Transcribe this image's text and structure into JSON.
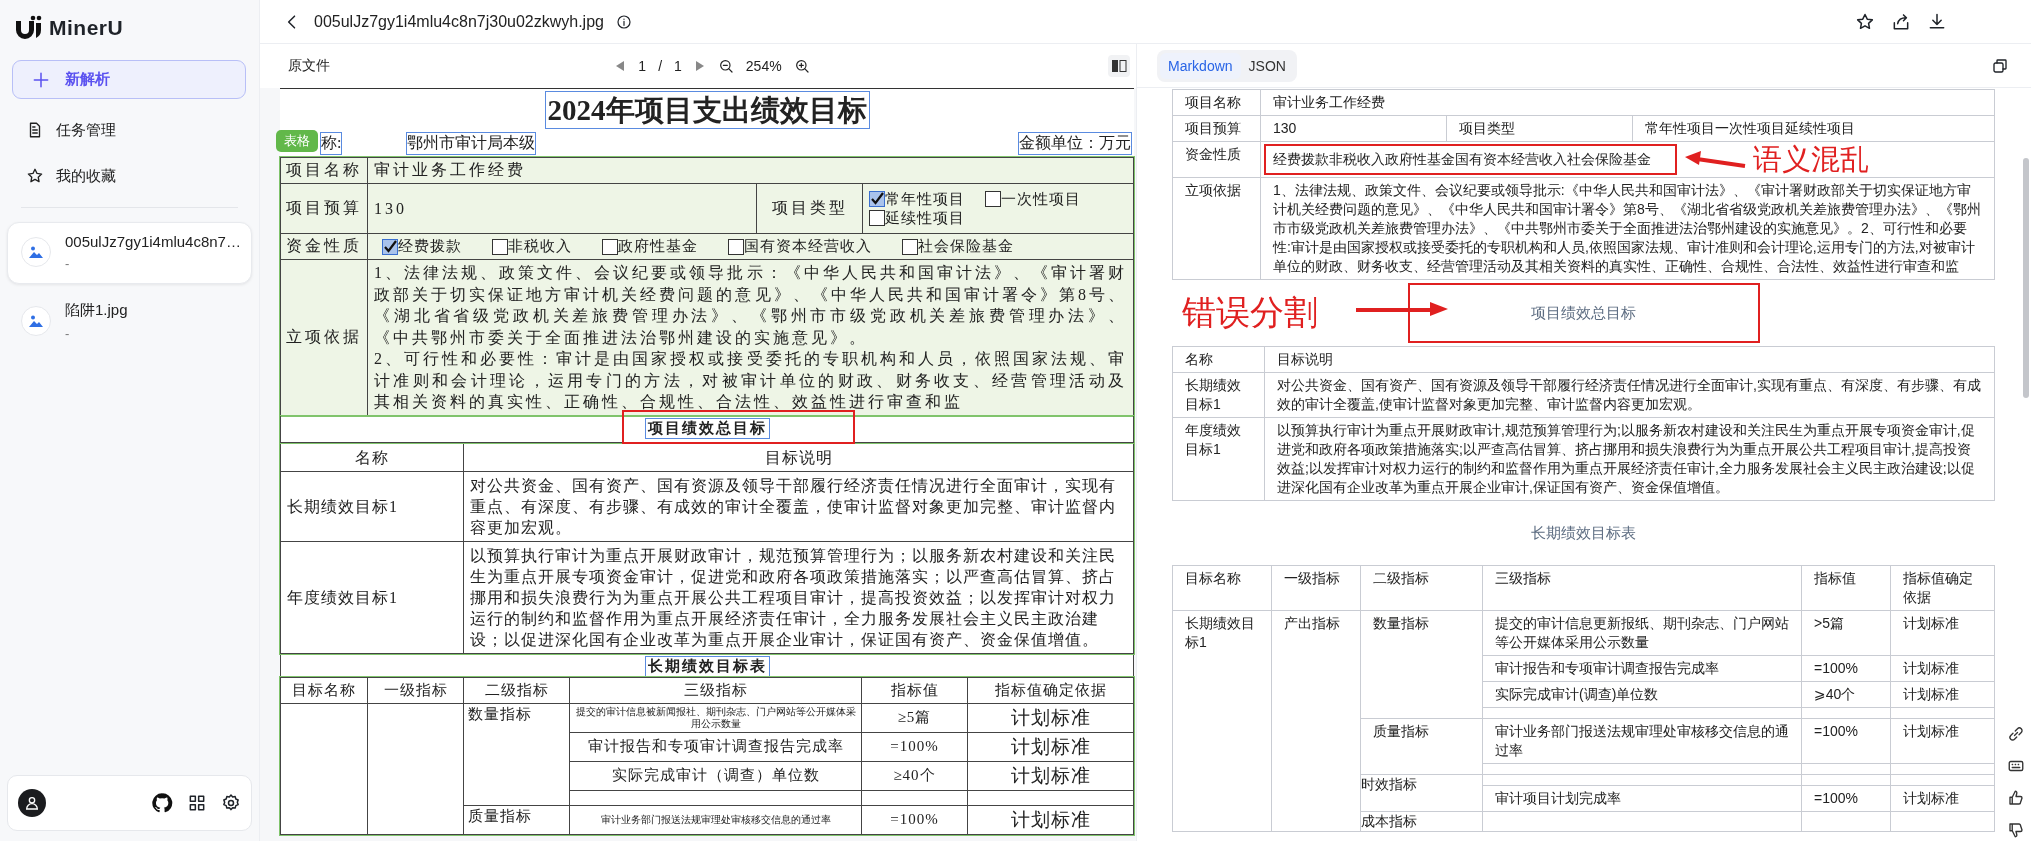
{
  "sidebar": {
    "logo": "MinerU",
    "new_task": "新解析",
    "nav": [
      "任务管理",
      "我的收藏"
    ],
    "files": [
      {
        "name": "005ulJz7gy1i4mlu4c8n7…",
        "meta": "-",
        "selected": true
      },
      {
        "name": "陷阱1.jpg",
        "meta": "-",
        "selected": false
      }
    ]
  },
  "header": {
    "file_name": "005ulJz7gy1i4mlu4c8n7j30u02zkwyh.jpg"
  },
  "viewer": {
    "label": "原文件",
    "page": "1",
    "page_separator": "/",
    "page_count": "1",
    "zoom": "254%"
  },
  "document": {
    "title": "2024年项目支出绩效目标",
    "block_tag": "表格",
    "unit_label": "称:",
    "unit_name": "鄂州市审计局本级",
    "amount_unit": "金额单位：万元",
    "project_name_label": "项目名称",
    "project_name": "审计业务工作经费",
    "budget_label": "项目预算",
    "budget": "130",
    "type_label": "项目类型",
    "project_types": [
      {
        "label": "常年性项目",
        "checked": true
      },
      {
        "label": "延续性项目",
        "checked": false
      },
      {
        "label": "一次性项目",
        "checked": false
      }
    ],
    "fund_label": "资金性质",
    "fund_types": [
      {
        "label": "经费拨款",
        "checked": true
      },
      {
        "label": "非税收入",
        "checked": false
      },
      {
        "label": "政府性基金",
        "checked": false
      },
      {
        "label": "国有资本经营收入",
        "checked": false
      },
      {
        "label": "社会保险基金",
        "checked": false
      }
    ],
    "basis_label": "立项依据",
    "basis": [
      "1、法律法规、政策文件、会议纪要或领导批示：《中华人民共和国审计法》、《审计署财政部关于切实保证地方审计机关经费问题的意见》、《中华人民共和国审计署令》第8号、《湖北省省级党政机关差旅费管理办法》、《鄂州市市级党政机关差旅费管理办法》、《中共鄂州市委关于全面推进法治鄂州建设的实施意见》。",
      "2、可行性和必要性：审计是由国家授权或接受委托的专职机构和人员，依照国家法规、审计准则和会计理论，运用专门的方法，对被审计单位的财政、财务收支、经营管理活动及其相关资料的真实性、正确性、合规性、合法性、效益性进行审查和监"
    ],
    "goal_section": "项目绩效总目标",
    "goal_section_flagged": true,
    "goal_columns": [
      "名称",
      "目标说明"
    ],
    "goals": [
      {
        "name": "长期绩效目标1",
        "text": "对公共资金、国有资产、国有资源及领导干部履行经济责任情况进行全面审计，实现有重点、有深度、有步骤、有成效的审计全覆盖，使审计监督对象更加完整、审计监督内容更加宏观。"
      },
      {
        "name": "年度绩效目标1",
        "text": "以预算执行审计为重点开展财政审计，规范预算管理行为；以服务新农村建设和关注民生为重点开展专项资金审计，促进党和政府各项政策措施落实；以严查高估冒算、挤占挪用和损失浪费行为为重点开展公共工程项目审计，提高投资效益；以发挥审计对权力运行的制约和监督作用为重点开展经济责任审计，全力服务发展社会主义民主政治建设；以促进深化国有企业改革为重点开展企业审计，保证国有资产、资金保值增值。"
      }
    ],
    "indicator_section": "长期绩效目标表",
    "indicator_columns": [
      "目标名称",
      "一级指标",
      "二级指标",
      "三级指标",
      "指标值",
      "指标值确定依据"
    ],
    "indicator_groups": [
      {
        "name": "数量指标",
        "rows": [
          {
            "kind": "small",
            "text": "提交的审计信息被新闻报社、期刊杂志、门户网站等公开媒体采用公示数量",
            "value": "≥5篇",
            "basis": "计划标准"
          },
          {
            "kind": "normal",
            "text": "审计报告和专项审计调查报告完成率",
            "value": "=100%",
            "basis": "计划标准"
          },
          {
            "kind": "normal",
            "text": "实际完成审计（调查）单位数",
            "value": "≥40个",
            "basis": "计划标准"
          },
          {
            "kind": "blank"
          }
        ]
      },
      {
        "name": "质量指标",
        "rows": [
          {
            "kind": "small",
            "text": "审计业务部门报送法规审理处审核移交信息的通过率",
            "value": "=100%",
            "basis": "计划标准"
          }
        ]
      }
    ]
  },
  "result": {
    "tabs": [
      {
        "label": "Markdown",
        "selected": true
      },
      {
        "label": "JSON",
        "selected": false
      }
    ],
    "summary_rows": [
      {
        "cells": [
          "项目名称",
          "审计业务工作经费"
        ]
      },
      {
        "cells": [
          "项目预算",
          "130",
          "项目类型",
          "常年性项目一次性项目延续性项目"
        ]
      },
      {
        "cells": [
          "资金性质",
          "经费拨款非税收入政府性基金国有资本经营收入社会保险基金"
        ],
        "annotation": "语义混乱"
      },
      {
        "cells": [
          "立项依据",
          "1、法律法规、政策文件、会议纪要或领导批示:《中华人民共和国审计法》、《审计署财政部关于切实保证地方审计机关经费问题的意见》、《中华人民共和国审计署令》第8号、《湖北省省级党政机关差旅费管理办法》、《鄂州市市级党政机关差旅费管理办法》、《中共鄂州市委关于全面推进法治鄂州建设的实施意见》。2、可行性和必要性:审计是由国家授权或接受委托的专职机构和人员,依照国家法规、审计准则和会计理论,运用专门的方法,对被审计单位的财政、财务收支、经营管理活动及其相关资料的真实性、正确性、合规性、合法性、效益性进行审查和监"
        ]
      }
    ],
    "goal_caption": "项目绩效总目标",
    "goal_caption_annotation": "错误分割",
    "goal_columns": [
      "名称",
      "目标说明"
    ],
    "goals": [
      {
        "name": "长期绩效目标1",
        "text": "对公共资金、国有资产、国有资源及领导干部履行经济责任情况进行全面审计,实现有重点、有深度、有步骤、有成效的审计全覆盖,使审计监督对象更加完整、审计监督内容更加宏观。"
      },
      {
        "name": "年度绩效目标1",
        "text": "以预算执行审计为重点开展财政审计,规范预算管理行为;以服务新农村建设和关注民生为重点开展专项资金审计,促进党和政府各项政策措施落实;以严查高估冒算、挤占挪用和损失浪费行为为重点开展公共工程项目审计,提高投资效益;以发挥审计对权力运行的制约和监督作用为重点开展经济责任审计,全力服务发展社会主义民主政治建设;以促进深化国有企业改革为重点开展企业审计,保证国有资产、资金保值增值。"
      }
    ],
    "indicator_caption": "长期绩效目标表",
    "indicator_columns": [
      "目标名称",
      "一级指标",
      "二级指标",
      "三级指标",
      "指标值",
      "指标值确定依据"
    ],
    "indicator_goal": "长期绩效目标1",
    "indicator_level1": "产出指标",
    "indicator_groups": [
      {
        "name": "数量指标",
        "rows": [
          {
            "kind": "normal",
            "text": "提交的审计信息更新报纸、期刊杂志、门户网站等公开媒体采用公示数量",
            "value": ">5篇",
            "basis": "计划标准"
          },
          {
            "kind": "normal",
            "text": "审计报告和专项审计调查报告完成率",
            "value": "=100%",
            "basis": "计划标准"
          },
          {
            "kind": "normal",
            "text": "实际完成审计(调查)单位数",
            "value": "⩾40个",
            "basis": "计划标准"
          },
          {
            "kind": "blank"
          }
        ]
      },
      {
        "name": "质量指标",
        "rows": [
          {
            "kind": "normal",
            "text": "审计业务部门报送法规审理处审核移交信息的通过率",
            "value": "=100%",
            "basis": "计划标准"
          },
          {
            "kind": "blank"
          }
        ]
      },
      {
        "name": "时效指标",
        "rows": [
          {
            "kind": "blank"
          },
          {
            "kind": "normal",
            "text": "审计项目计划完成率",
            "value": "=100%",
            "basis": "计划标准"
          }
        ]
      },
      {
        "name": "成本指标",
        "rows": [
          {
            "kind": "blank"
          }
        ]
      }
    ]
  }
}
